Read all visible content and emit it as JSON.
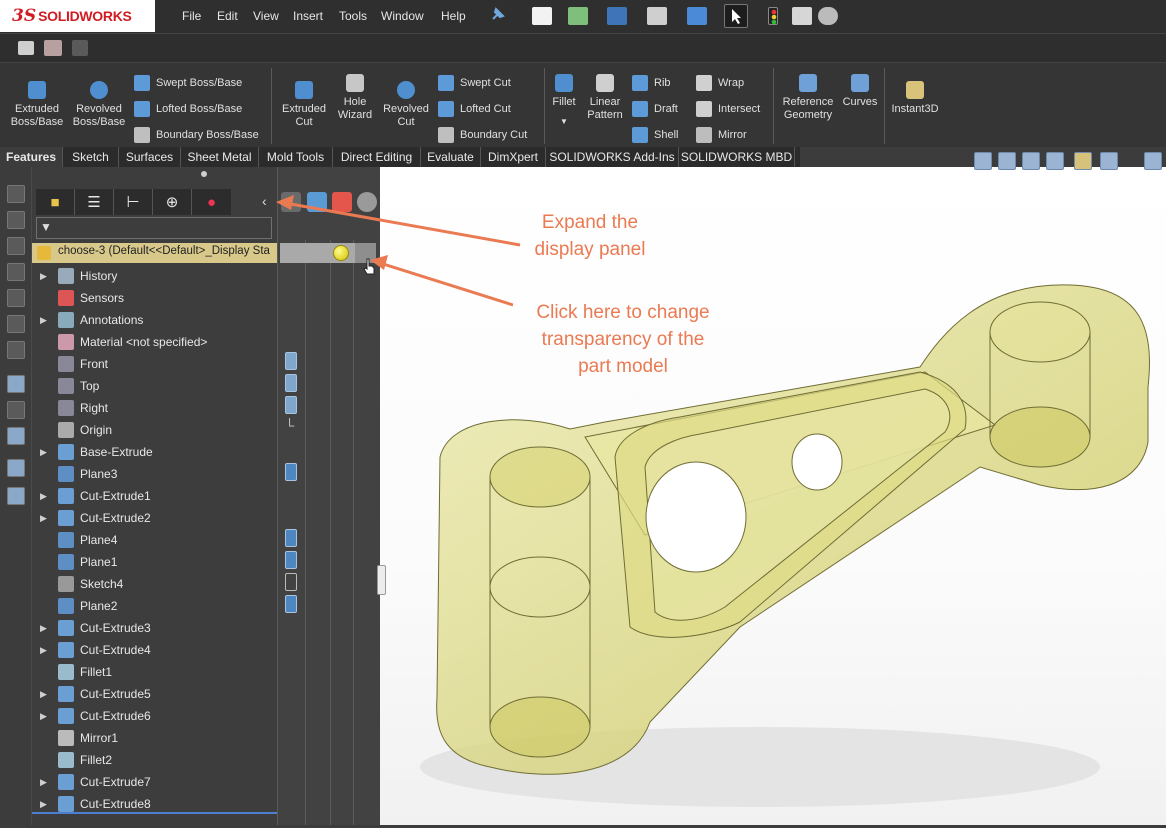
{
  "app": {
    "brand": "SOLIDWORKS",
    "brand_prefix": "3S"
  },
  "menu": [
    "File",
    "Edit",
    "View",
    "Insert",
    "Tools",
    "Window",
    "Help"
  ],
  "command_manager": {
    "features_large": [
      {
        "label": "Extruded\nBoss/Base",
        "icon": "extruded-boss-icon"
      },
      {
        "label": "Revolved\nBoss/Base",
        "icon": "revolved-boss-icon"
      }
    ],
    "features_small": [
      {
        "label": "Swept Boss/Base",
        "icon": "swept-boss-icon"
      },
      {
        "label": "Lofted Boss/Base",
        "icon": "lofted-boss-icon"
      },
      {
        "label": "Boundary Boss/Base",
        "icon": "boundary-boss-icon"
      }
    ],
    "cut_large": [
      {
        "label": "Extruded\nCut",
        "icon": "extruded-cut-icon"
      },
      {
        "label": "Hole\nWizard",
        "icon": "hole-wizard-icon"
      },
      {
        "label": "Revolved\nCut",
        "icon": "revolved-cut-icon"
      }
    ],
    "cut_small": [
      {
        "label": "Swept Cut",
        "icon": "swept-cut-icon"
      },
      {
        "label": "Lofted Cut",
        "icon": "lofted-cut-icon"
      },
      {
        "label": "Boundary Cut",
        "icon": "boundary-cut-icon"
      }
    ],
    "fillet": {
      "label": "Fillet",
      "icon": "fillet-icon"
    },
    "linear_pattern": {
      "label": "Linear\nPattern",
      "icon": "linear-pattern-icon"
    },
    "mid_small": [
      {
        "label": "Rib",
        "icon": "rib-icon"
      },
      {
        "label": "Draft",
        "icon": "draft-icon"
      },
      {
        "label": "Shell",
        "icon": "shell-icon"
      }
    ],
    "right_small": [
      {
        "label": "Wrap",
        "icon": "wrap-icon"
      },
      {
        "label": "Intersect",
        "icon": "intersect-icon"
      },
      {
        "label": "Mirror",
        "icon": "mirror-icon"
      }
    ],
    "reference_geometry": {
      "label": "Reference\nGeometry",
      "icon": "reference-geometry-icon"
    },
    "curves": {
      "label": "Curves",
      "icon": "curves-icon"
    },
    "instant3d": {
      "label": "Instant3D",
      "icon": "instant3d-icon"
    }
  },
  "tabs": [
    {
      "label": "Features",
      "active": true
    },
    {
      "label": "Sketch",
      "active": false
    },
    {
      "label": "Surfaces",
      "active": false
    },
    {
      "label": "Sheet Metal",
      "active": false
    },
    {
      "label": "Mold Tools",
      "active": false
    },
    {
      "label": "Direct Editing",
      "active": false
    },
    {
      "label": "Evaluate",
      "active": false
    },
    {
      "label": "DimXpert",
      "active": false
    },
    {
      "label": "SOLIDWORKS Add-Ins",
      "active": false
    },
    {
      "label": "SOLIDWORKS MBD",
      "active": false
    }
  ],
  "tree": {
    "root": "choose-3  (Default<<Default>_Display Sta",
    "items": [
      {
        "label": "History",
        "expandable": true,
        "icon": "history-icon",
        "color": "#9ab"
      },
      {
        "label": "Sensors",
        "expandable": false,
        "icon": "sensors-icon",
        "color": "#d55"
      },
      {
        "label": "Annotations",
        "expandable": true,
        "icon": "annotations-icon",
        "color": "#8ab"
      },
      {
        "label": "Material <not specified>",
        "expandable": false,
        "icon": "material-icon",
        "color": "#c9a"
      },
      {
        "label": "Front",
        "expandable": false,
        "icon": "plane-icon",
        "color": "#889"
      },
      {
        "label": "Top",
        "expandable": false,
        "icon": "plane-icon",
        "color": "#889"
      },
      {
        "label": "Right",
        "expandable": false,
        "icon": "plane-icon",
        "color": "#889"
      },
      {
        "label": "Origin",
        "expandable": false,
        "icon": "origin-icon",
        "color": "#aaa"
      },
      {
        "label": "Base-Extrude",
        "expandable": true,
        "icon": "extrude-feature-icon",
        "color": "#6b9fd4"
      },
      {
        "label": "Plane3",
        "expandable": false,
        "icon": "plane-icon",
        "color": "#5e8fc4"
      },
      {
        "label": "Cut-Extrude1",
        "expandable": true,
        "icon": "cut-extrude-icon",
        "color": "#6b9fd4"
      },
      {
        "label": "Cut-Extrude2",
        "expandable": true,
        "icon": "cut-extrude-icon",
        "color": "#6b9fd4"
      },
      {
        "label": "Plane4",
        "expandable": false,
        "icon": "plane-icon",
        "color": "#5e8fc4"
      },
      {
        "label": "Plane1",
        "expandable": false,
        "icon": "plane-icon",
        "color": "#5e8fc4"
      },
      {
        "label": "Sketch4",
        "expandable": false,
        "icon": "sketch-icon",
        "color": "#999"
      },
      {
        "label": "Plane2",
        "expandable": false,
        "icon": "plane-icon",
        "color": "#5e8fc4"
      },
      {
        "label": "Cut-Extrude3",
        "expandable": true,
        "icon": "cut-extrude-icon",
        "color": "#6b9fd4"
      },
      {
        "label": "Cut-Extrude4",
        "expandable": true,
        "icon": "cut-extrude-icon",
        "color": "#6b9fd4"
      },
      {
        "label": "Fillet1",
        "expandable": false,
        "icon": "fillet-feature-icon",
        "color": "#9bc"
      },
      {
        "label": "Cut-Extrude5",
        "expandable": true,
        "icon": "cut-extrude-icon",
        "color": "#6b9fd4"
      },
      {
        "label": "Cut-Extrude6",
        "expandable": true,
        "icon": "cut-extrude-icon",
        "color": "#6b9fd4"
      },
      {
        "label": "Mirror1",
        "expandable": false,
        "icon": "mirror-feature-icon",
        "color": "#bbb"
      },
      {
        "label": "Fillet2",
        "expandable": false,
        "icon": "fillet-feature-icon",
        "color": "#9bc"
      },
      {
        "label": "Cut-Extrude7",
        "expandable": true,
        "icon": "cut-extrude-icon",
        "color": "#6b9fd4"
      },
      {
        "label": "Cut-Extrude8",
        "expandable": true,
        "icon": "cut-extrude-icon",
        "color": "#6b9fd4"
      }
    ]
  },
  "annotations": {
    "expand": "Expand the\ndisplay panel",
    "transparency": "Click here to change\ntransparency of the\npart model",
    "color": "#ea7a52"
  },
  "model": {
    "color": "#d9d77a"
  }
}
